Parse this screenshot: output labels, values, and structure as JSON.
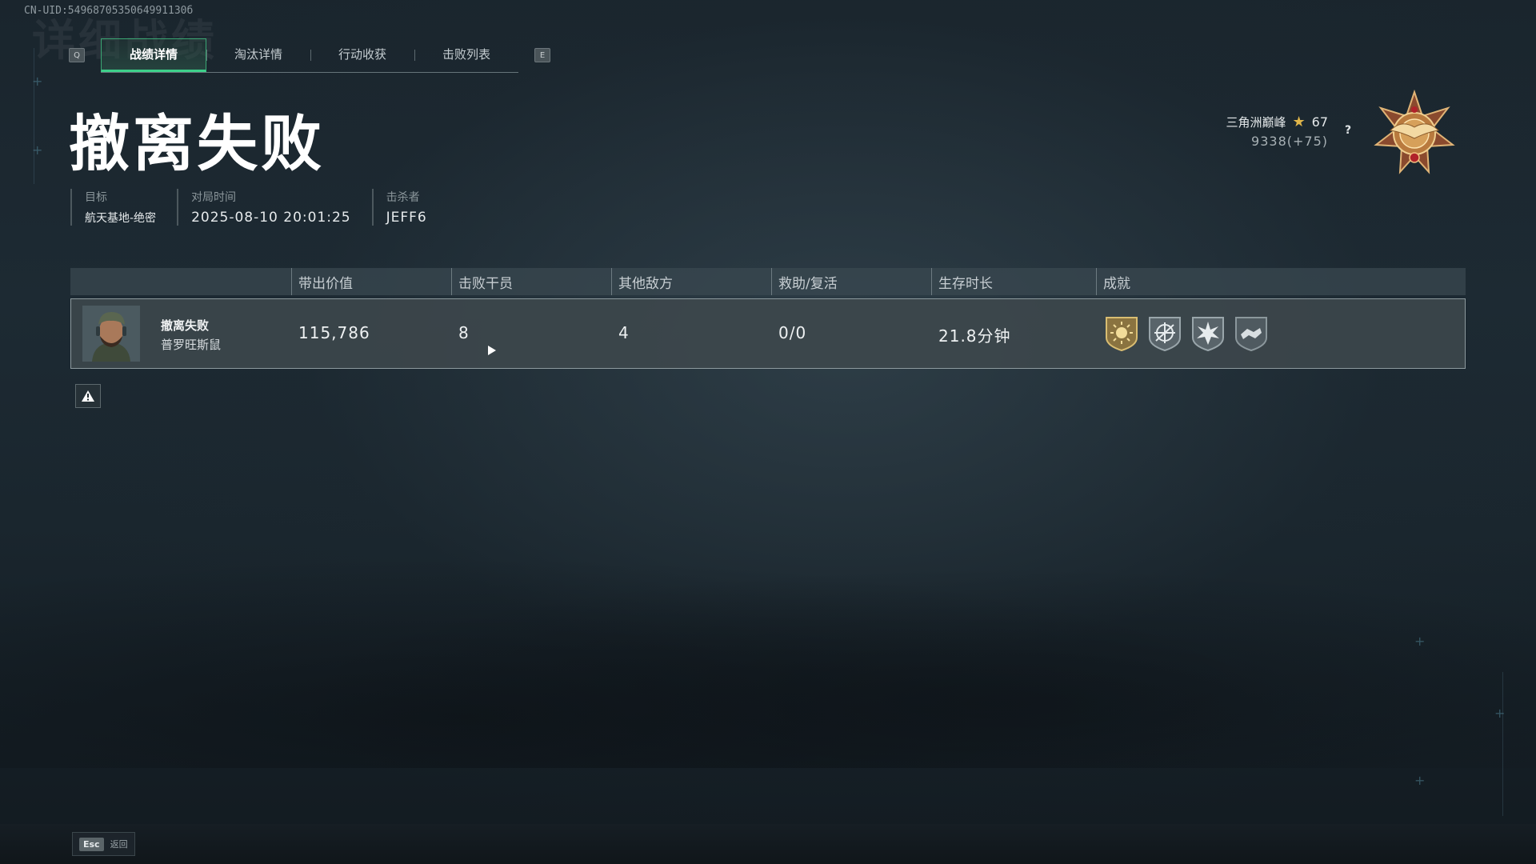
{
  "uid": "CN-UID:5496870535064991130б",
  "watermark": "详细战绩",
  "tabs": {
    "left_key": "Q",
    "right_key": "E",
    "items": [
      {
        "label": "战绩详情",
        "active": true
      },
      {
        "label": "淘汰详情",
        "active": false
      },
      {
        "label": "行动收获",
        "active": false
      },
      {
        "label": "击败列表",
        "active": false
      }
    ]
  },
  "result_title": "撤离失败",
  "info": {
    "target": {
      "label": "目标",
      "value": "航天基地-绝密"
    },
    "match_time": {
      "label": "对局时间",
      "value": "2025-08-10 20:01:25"
    },
    "killer": {
      "label": "击杀者",
      "value": "JEFF6"
    }
  },
  "rank": {
    "tier_name": "三角洲巅峰",
    "stars": "67",
    "score": "9338(+75)",
    "help": "?"
  },
  "table": {
    "headers": [
      "带出价值",
      "击败干员",
      "其他敌方",
      "救助/复活",
      "生存时长",
      "成就"
    ],
    "row": {
      "status": "撤离失败",
      "player_name": "普罗旺斯鼠",
      "extract_value": "115,786",
      "operators_defeated": "8",
      "other_enemies": "4",
      "assist_revive": "0/0",
      "survival_time": "21.8分钟",
      "achievements": [
        "gold-sun-badge",
        "crosshair-badge",
        "star-burst-badge",
        "handshake-badge"
      ]
    }
  },
  "footer": {
    "esc_key": "Esc",
    "esc_label": "返回"
  },
  "colors": {
    "accent_green": "#3dd08a",
    "gold": "#e0b64a"
  }
}
